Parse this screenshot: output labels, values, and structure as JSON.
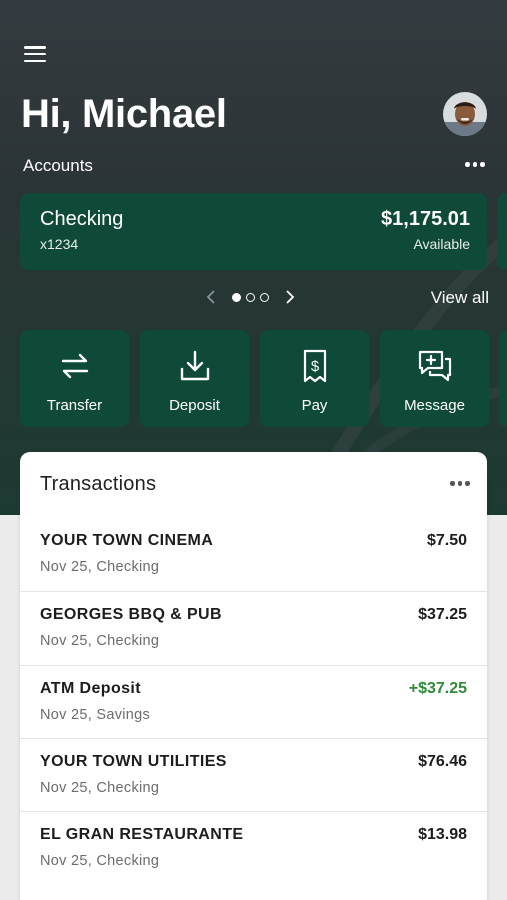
{
  "header": {
    "greeting": "Hi, Michael",
    "accounts_label": "Accounts"
  },
  "account": {
    "name": "Checking",
    "number": "x1234",
    "balance": "$1,175.01",
    "balance_label": "Available"
  },
  "pager": {
    "page_count": 3,
    "active_index": 0,
    "view_all_label": "View all"
  },
  "actions": [
    {
      "label": "Transfer",
      "icon": "transfer-icon"
    },
    {
      "label": "Deposit",
      "icon": "deposit-icon"
    },
    {
      "label": "Pay",
      "icon": "pay-bill-icon"
    },
    {
      "label": "Message",
      "icon": "message-icon"
    }
  ],
  "transactions": {
    "title": "Transactions",
    "items": [
      {
        "name": "YOUR TOWN CINEMA",
        "details": "Nov 25, Checking",
        "amount": "$7.50",
        "positive": false
      },
      {
        "name": "GEORGES BBQ & PUB",
        "details": "Nov 25, Checking",
        "amount": "$37.25",
        "positive": false
      },
      {
        "name": "ATM Deposit",
        "details": "Nov 25, Savings",
        "amount": "+$37.25",
        "positive": true
      },
      {
        "name": "YOUR TOWN UTILITIES",
        "details": "Nov 25, Checking",
        "amount": "$76.46",
        "positive": false
      },
      {
        "name": "EL GRAN RESTAURANTE",
        "details": "Nov 25, Checking",
        "amount": "$13.98",
        "positive": false
      }
    ]
  },
  "colors": {
    "card_green": "#0e4a37",
    "positive_amount": "#2f8a3a",
    "hero_dark": "#2b3436"
  }
}
